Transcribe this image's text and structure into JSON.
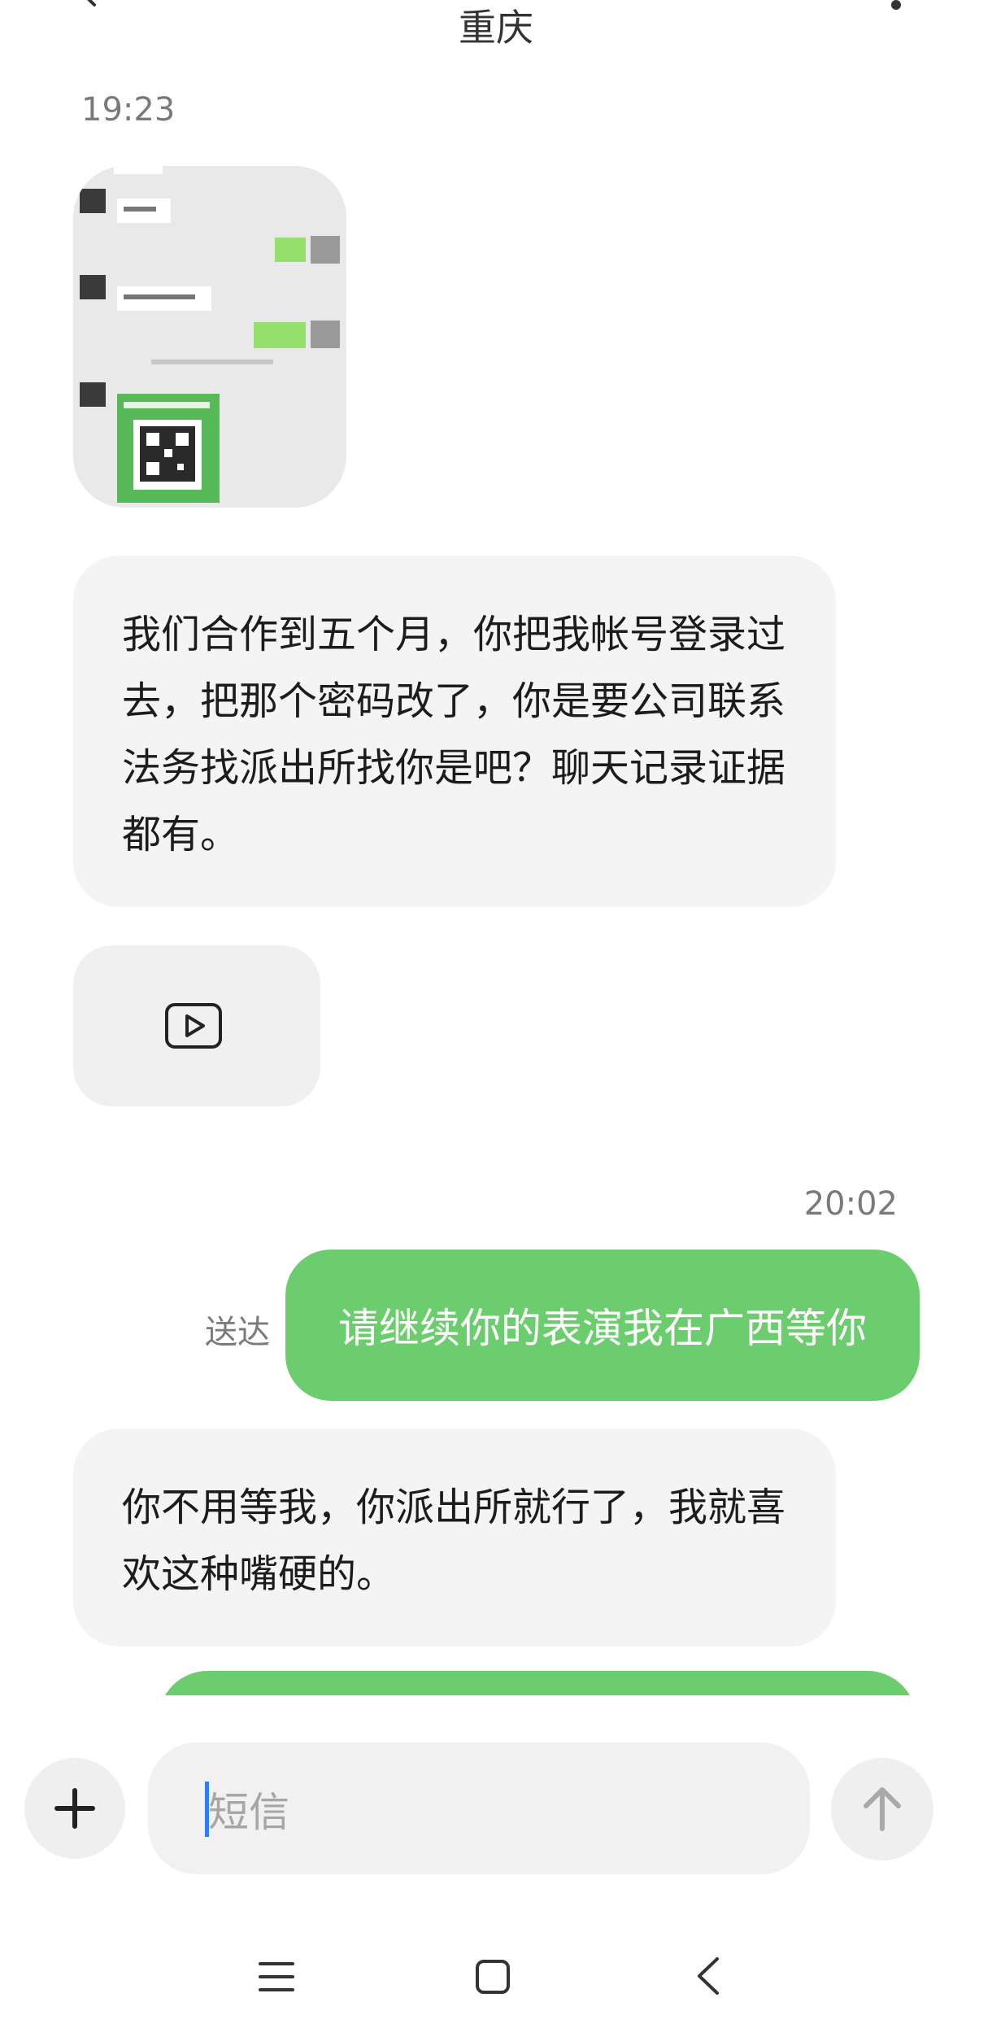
{
  "header": {
    "title": "重庆",
    "back_icon": "chevron-left-icon",
    "menu_icon": "more-icon"
  },
  "messages": {
    "timestamp_1": "19:23",
    "incoming_1": "我们合作到五个月，你把我帐号登录过去，把那个密码改了，你是要公司联系法务找派出所找你是吧？聊天记录证据都有。",
    "timestamp_2": "20:02",
    "outgoing_1": "请继续你的表演我在广西等你",
    "outgoing_1_status": "送达",
    "incoming_2": "你不用等我，你派出所就行了，我就喜欢这种嘴硬的。"
  },
  "composer": {
    "placeholder": "短信",
    "add_icon": "plus-icon",
    "send_icon": "arrow-up-icon"
  },
  "navbar": {
    "menu_icon": "menu-icon",
    "home_icon": "square-home-icon",
    "back_icon": "chevron-left-icon"
  },
  "colors": {
    "outgoing_bubble": "#6ccd6e",
    "incoming_bubble": "#f4f4f4",
    "caret": "#2f7cf6"
  }
}
